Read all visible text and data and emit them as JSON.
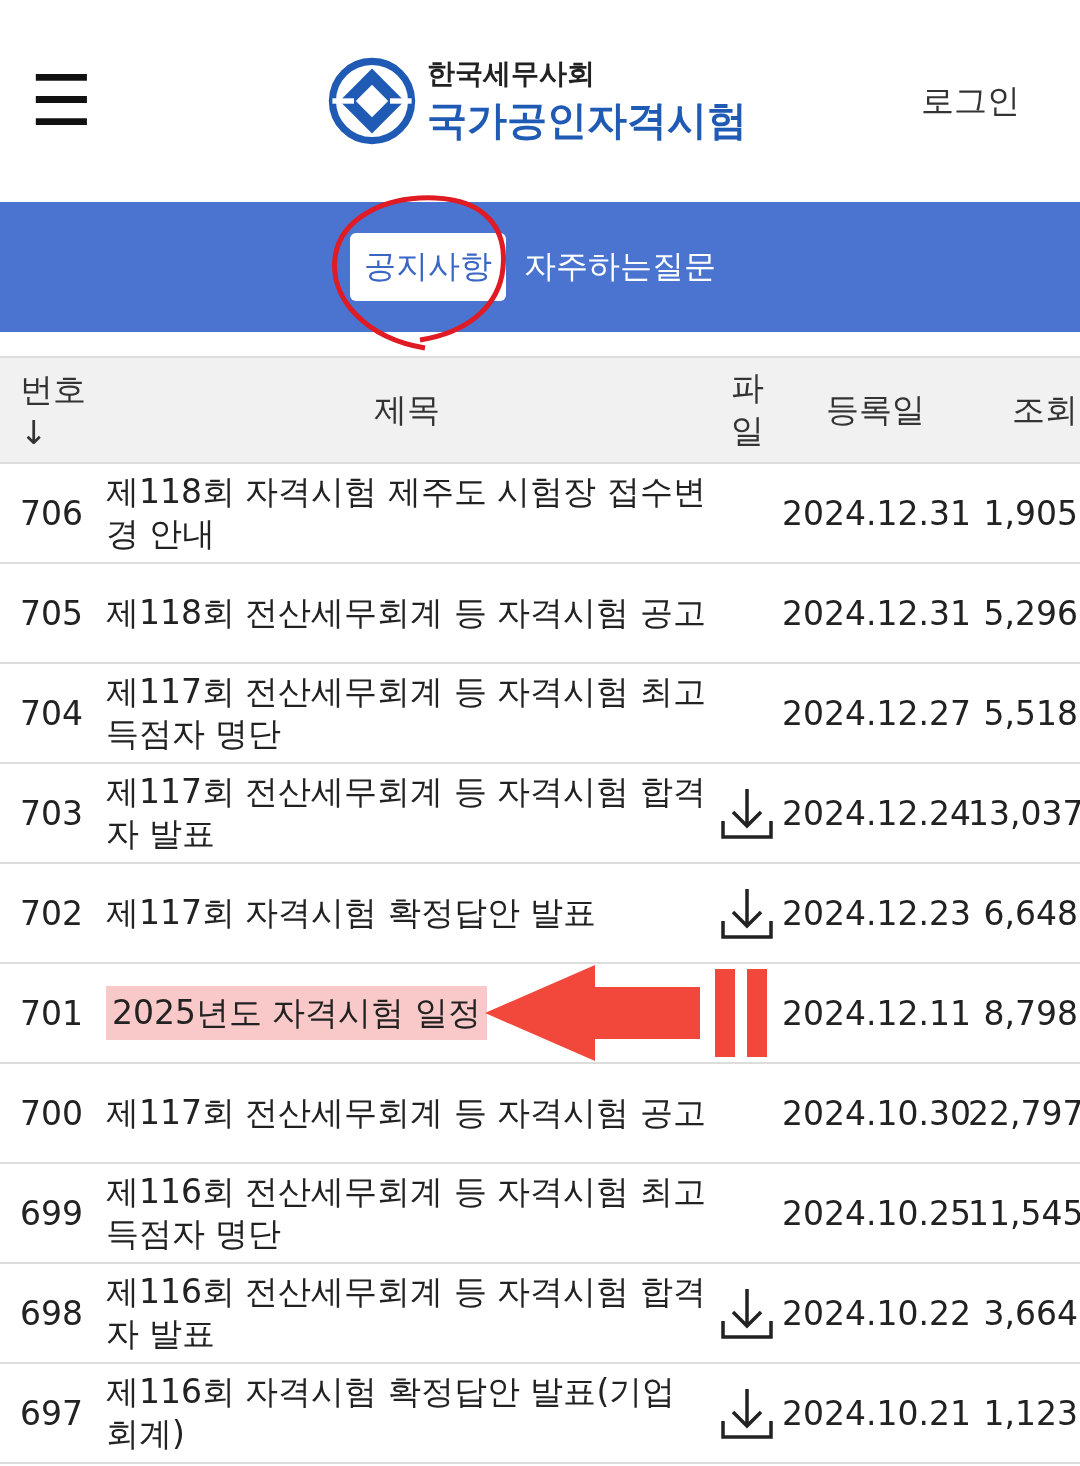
{
  "header": {
    "menu_icon": "☰",
    "org": "한국세무사회",
    "title": "국가공인자격시험",
    "login": "로그인"
  },
  "tabs": [
    {
      "label": "공지사항",
      "selected": true,
      "circled": true
    },
    {
      "label": "자주하는질문",
      "selected": false,
      "circled": false
    }
  ],
  "table": {
    "columns": [
      "번호",
      "제목",
      "파일",
      "등록일",
      "조회"
    ],
    "sort_arrow": "↓",
    "rows": [
      {
        "no": "706",
        "title": "제118회 자격시험 제주도 시험장 접수변경 안내",
        "has_file": false,
        "date": "2024.12.31",
        "views": "1,905",
        "highlighted": false
      },
      {
        "no": "705",
        "title": "제118회 전산세무회계 등 자격시험 공고",
        "has_file": false,
        "date": "2024.12.31",
        "views": "5,296",
        "highlighted": false
      },
      {
        "no": "704",
        "title": "제117회 전산세무회계 등 자격시험 최고득점자 명단",
        "has_file": false,
        "date": "2024.12.27",
        "views": "5,518",
        "highlighted": false
      },
      {
        "no": "703",
        "title": "제117회 전산세무회계 등 자격시험 합격자 발표",
        "has_file": true,
        "date": "2024.12.24",
        "views": "13,037",
        "highlighted": false
      },
      {
        "no": "702",
        "title": "제117회 자격시험 확정답안 발표",
        "has_file": true,
        "date": "2024.12.23",
        "views": "6,648",
        "highlighted": false
      },
      {
        "no": "701",
        "title": "2025년도 자격시험 일정",
        "has_file": false,
        "date": "2024.12.11",
        "views": "8,798",
        "highlighted": true
      },
      {
        "no": "700",
        "title": "제117회 전산세무회계 등 자격시험 공고",
        "has_file": false,
        "date": "2024.10.30",
        "views": "22,797",
        "highlighted": false
      },
      {
        "no": "699",
        "title": "제116회 전산세무회계 등 자격시험 최고득점자 명단",
        "has_file": false,
        "date": "2024.10.25",
        "views": "11,545",
        "highlighted": false
      },
      {
        "no": "698",
        "title": "제116회 전산세무회계 등 자격시험 합격자 발표",
        "has_file": true,
        "date": "2024.10.22",
        "views": "3,664",
        "highlighted": false
      },
      {
        "no": "697",
        "title": "제116회 자격시험 확정답안 발표(기업회계)",
        "has_file": true,
        "date": "2024.10.21",
        "views": "1,123",
        "highlighted": false
      }
    ]
  }
}
